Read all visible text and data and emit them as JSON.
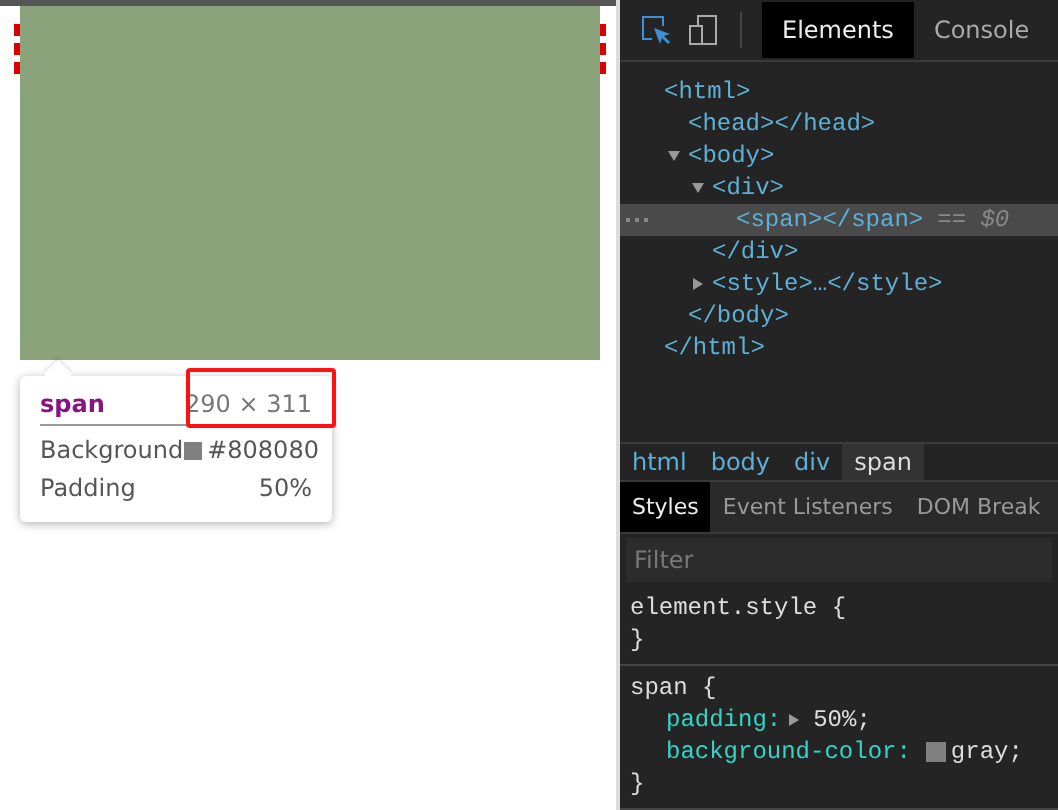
{
  "page": {
    "tooltip": {
      "tag": "span",
      "dimensions": "290 × 311",
      "rows": [
        {
          "label": "Background",
          "value": "#808080",
          "color": "#808080"
        },
        {
          "label": "Padding",
          "value": "50%"
        }
      ]
    }
  },
  "devtools": {
    "tabs": [
      {
        "label": "Elements",
        "selected": true
      },
      {
        "label": "Console",
        "selected": false
      }
    ],
    "dom_tree": [
      {
        "open": "<html>",
        "close": "</html>",
        "children": [
          {
            "open": "<head></head>"
          },
          {
            "open": "<body>",
            "close": "</body>",
            "expanded": true,
            "children": [
              {
                "open": "<div>",
                "close": "</div>",
                "expanded": true,
                "children": [
                  {
                    "open": "<span></span>",
                    "suffix": "== $0",
                    "selected": true
                  }
                ]
              },
              {
                "open": "<style>…</style>",
                "expanded": false
              }
            ]
          }
        ]
      }
    ],
    "breadcrumbs": [
      {
        "label": "html",
        "selected": false
      },
      {
        "label": "body",
        "selected": false
      },
      {
        "label": "div",
        "selected": false
      },
      {
        "label": "span",
        "selected": true
      }
    ],
    "style_tabs": [
      {
        "label": "Styles",
        "selected": true
      },
      {
        "label": "Event Listeners",
        "selected": false
      },
      {
        "label": "DOM Break",
        "selected": false
      }
    ],
    "filter": {
      "placeholder": "Filter"
    },
    "rules": [
      {
        "selector": "element.style {",
        "close": "}"
      },
      {
        "selector": "span {",
        "close": "}",
        "declarations": [
          {
            "property": "padding:",
            "value": "50%;",
            "expanded": false
          },
          {
            "property": "background-color:",
            "value": "gray;",
            "color": "#808080"
          }
        ]
      }
    ]
  }
}
